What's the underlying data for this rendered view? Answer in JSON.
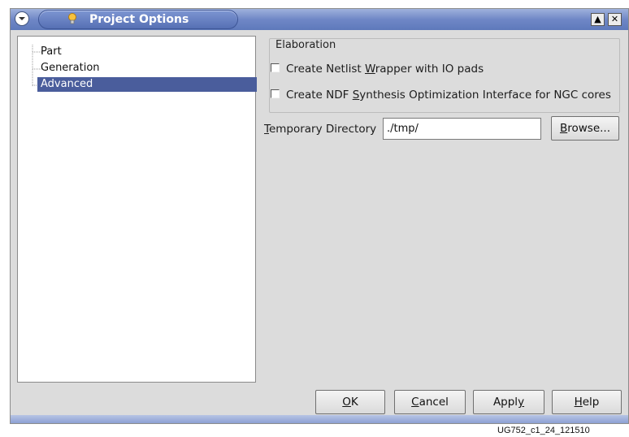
{
  "window": {
    "title": "Project Options",
    "controls": {
      "shade": "▲",
      "close": "✕"
    }
  },
  "tree": {
    "items": [
      {
        "label": "Part",
        "selected": false
      },
      {
        "label": "Generation",
        "selected": false
      },
      {
        "label": "Advanced",
        "selected": true
      }
    ]
  },
  "elaboration": {
    "legend": "Elaboration",
    "option1": {
      "pre": "Create Netlist ",
      "mnemonic": "W",
      "post": "rapper with IO pads",
      "checked": false
    },
    "option2": {
      "pre": "Create NDF ",
      "mnemonic": "S",
      "post": "ynthesis Optimization Interface for NGC cores",
      "checked": false
    }
  },
  "temp_dir": {
    "label_mnemonic": "T",
    "label_rest": "emporary Directory",
    "value": "./tmp/",
    "browse_mnemonic": "B",
    "browse_rest": "rowse..."
  },
  "buttons": {
    "ok": {
      "mnemonic": "O",
      "rest": "K"
    },
    "cancel": {
      "mnemonic": "C",
      "rest": "ancel"
    },
    "apply": {
      "mnemonic": "",
      "pre": "Appl",
      "post": "y"
    },
    "help": {
      "mnemonic": "H",
      "rest": "elp"
    }
  },
  "caption": "UG752_c1_24_121510",
  "colors": {
    "title_bar": "#6f87c6",
    "selection": "#4a5d9c",
    "dialog_bg": "#dcdcdc"
  }
}
